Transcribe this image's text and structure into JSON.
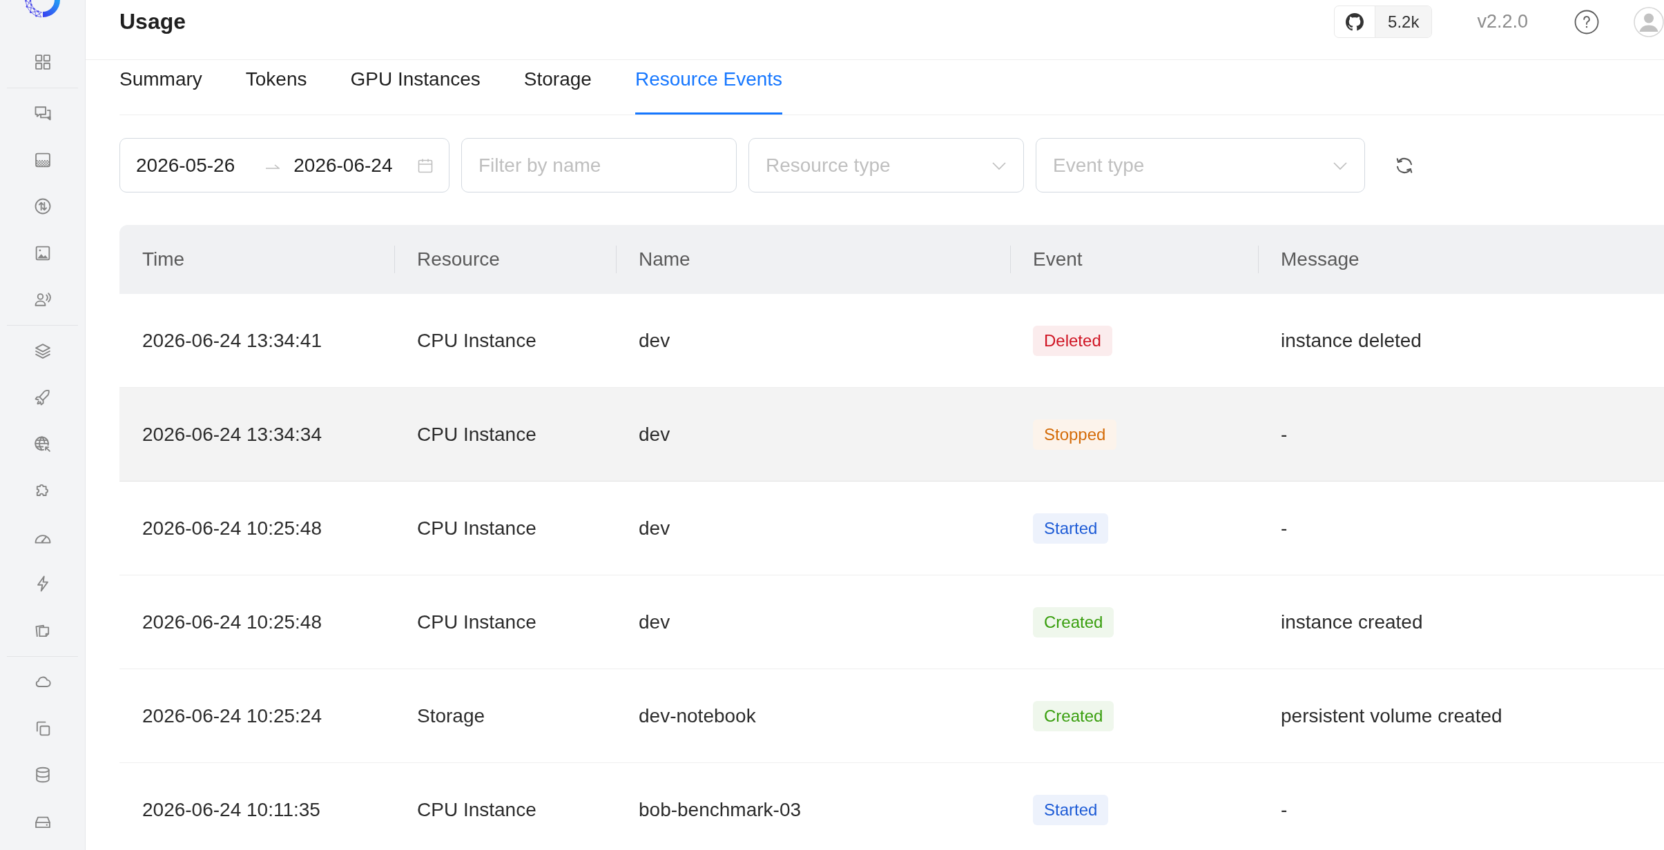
{
  "header": {
    "title": "Usage",
    "github": {
      "count": "5.2k"
    },
    "version": "v2.2.0"
  },
  "tabs": [
    {
      "label": "Summary",
      "selected": false
    },
    {
      "label": "Tokens",
      "selected": false
    },
    {
      "label": "GPU Instances",
      "selected": false
    },
    {
      "label": "Storage",
      "selected": false
    },
    {
      "label": "Resource Events",
      "selected": true
    }
  ],
  "filters": {
    "date_range": {
      "start": "2026-05-26",
      "end": "2026-06-24"
    },
    "name_filter": {
      "placeholder": "Filter by name"
    },
    "resource_type": {
      "placeholder": "Resource type"
    },
    "event_type": {
      "placeholder": "Event type"
    }
  },
  "table": {
    "columns": [
      "Time",
      "Resource",
      "Name",
      "Event",
      "Message"
    ],
    "rows": [
      {
        "time": "2026-06-24 13:34:41",
        "resource": "CPU Instance",
        "name": "dev",
        "event": {
          "label": "Deleted",
          "color": "#cf1322"
        },
        "message": "instance deleted",
        "hovered": false
      },
      {
        "time": "2026-06-24 13:34:34",
        "resource": "CPU Instance",
        "name": "dev",
        "event": {
          "label": "Stopped",
          "color": "#d46b08"
        },
        "message": "-",
        "hovered": true
      },
      {
        "time": "2026-06-24 10:25:48",
        "resource": "CPU Instance",
        "name": "dev",
        "event": {
          "label": "Started",
          "color": "#1d5bd6"
        },
        "message": "-",
        "hovered": false
      },
      {
        "time": "2026-06-24 10:25:48",
        "resource": "CPU Instance",
        "name": "dev",
        "event": {
          "label": "Created",
          "color": "#389e0d"
        },
        "message": "instance created",
        "hovered": false
      },
      {
        "time": "2026-06-24 10:25:24",
        "resource": "Storage",
        "name": "dev-notebook",
        "event": {
          "label": "Created",
          "color": "#389e0d"
        },
        "message": "persistent volume created",
        "hovered": false
      },
      {
        "time": "2026-06-24 10:11:35",
        "resource": "CPU Instance",
        "name": "bob-benchmark-03",
        "event": {
          "label": "Started",
          "color": "#1d5bd6"
        },
        "message": "-",
        "hovered": false
      }
    ]
  }
}
